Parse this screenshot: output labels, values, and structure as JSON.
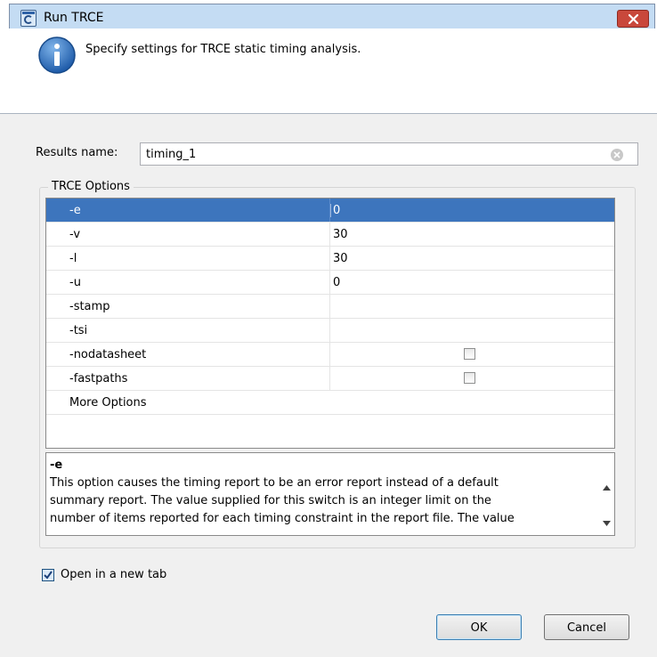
{
  "window": {
    "title": "Run TRCE",
    "close_icon": "close-icon",
    "app_icon": "app-icon"
  },
  "header": {
    "icon": "info-icon",
    "text": "Specify settings for TRCE static timing analysis."
  },
  "results": {
    "label": "Results name:",
    "value": "timing_1",
    "clear_icon": "clear-icon"
  },
  "options": {
    "group_label": "TRCE Options",
    "rows": [
      {
        "name": "-e",
        "value": "0",
        "selected": true
      },
      {
        "name": "-v",
        "value": "30"
      },
      {
        "name": "-l",
        "value": "30"
      },
      {
        "name": "-u",
        "value": "0"
      },
      {
        "name": "-stamp",
        "value": ""
      },
      {
        "name": "-tsi",
        "value": ""
      },
      {
        "name": "-nodatasheet",
        "checkbox": true,
        "checked": false
      },
      {
        "name": "-fastpaths",
        "checkbox": true,
        "checked": false
      },
      {
        "name": "More Options",
        "value": ""
      }
    ]
  },
  "description": {
    "title": "-e",
    "text": "This option causes the timing report to be an error report instead of a default\nsummary report. The value supplied for this switch is an integer limit on the\nnumber of items reported for each timing constraint in the report file. The value"
  },
  "open_new_tab": {
    "label": "Open in a new tab",
    "checked": true
  },
  "buttons": {
    "ok": "OK",
    "cancel": "Cancel"
  },
  "colors": {
    "selection": "#3d75bd",
    "titlebar": "#c4dcf3",
    "close": "#c9483b"
  }
}
